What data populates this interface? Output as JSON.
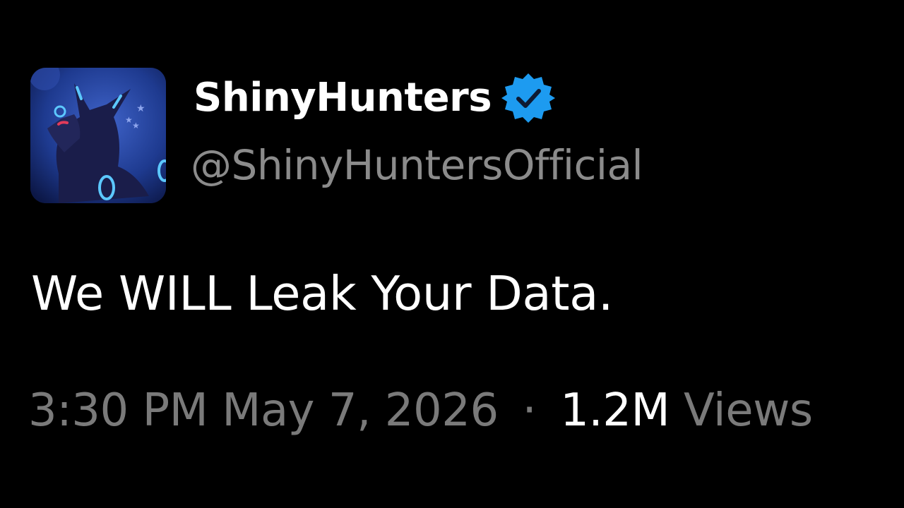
{
  "account": {
    "display_name": "ShinyHunters",
    "handle": "@ShinyHuntersOfficial",
    "verified": true,
    "avatar_icon": "umbreon-avatar-icon",
    "verified_icon": "verified-badge-icon"
  },
  "tweet": {
    "text": "We WILL Leak Your Data.",
    "time": "3:30 PM",
    "date": "May 7, 2026",
    "separator": "·",
    "views_count": "1.2M",
    "views_label": "Views"
  },
  "colors": {
    "background": "#000000",
    "text_primary": "#ffffff",
    "text_secondary": "#8b8b8b",
    "verified_badge": "#1d9bf0"
  }
}
